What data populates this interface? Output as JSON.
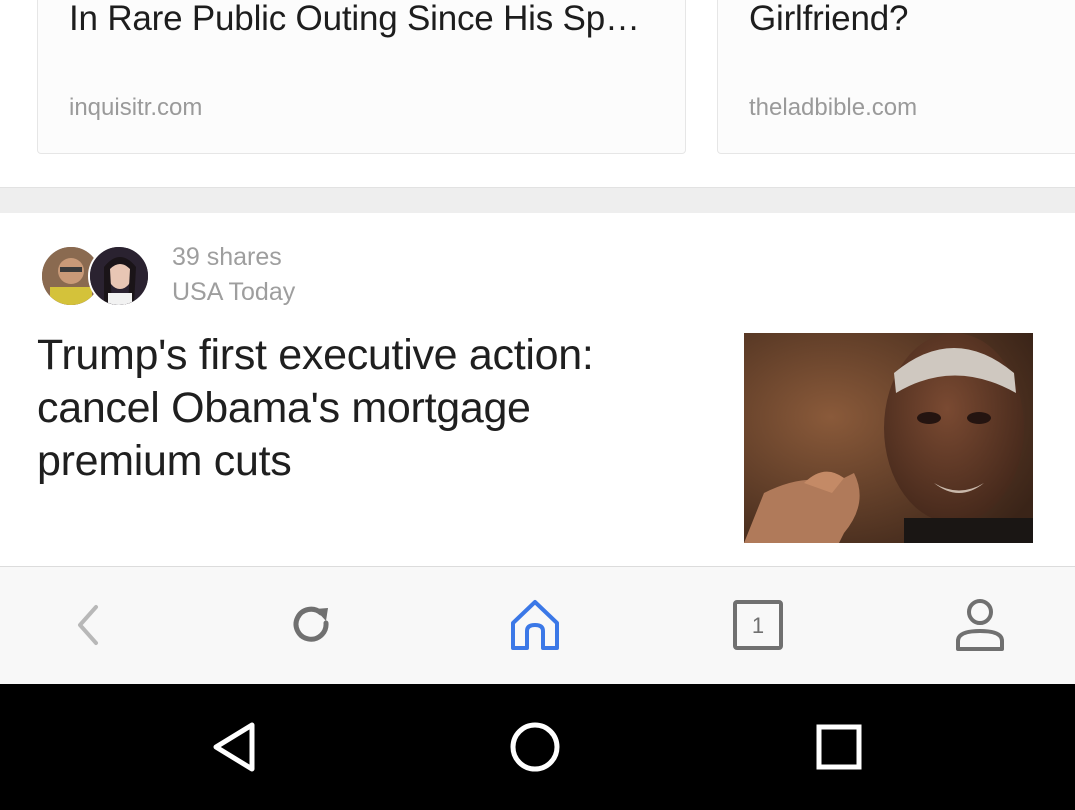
{
  "cards": [
    {
      "title": "In Rare Public Outing Since His Sp…",
      "source": "inquisitr.com"
    },
    {
      "title": "Girlfriend?",
      "source": "theladbible.com"
    }
  ],
  "story": {
    "shares": "39 shares",
    "source": "USA Today",
    "headline": "Trump's first executive action: cancel Obama's mortgage premium cuts"
  },
  "toolbar": {
    "tab_count": "1",
    "accent_color": "#3b78e7",
    "icon_color": "#707070",
    "icons": [
      "back-icon",
      "reload-icon",
      "home-icon",
      "tabs-icon",
      "profile-icon"
    ]
  },
  "system_nav": {
    "icons": [
      "back-triangle-icon",
      "home-circle-icon",
      "recents-square-icon"
    ]
  }
}
